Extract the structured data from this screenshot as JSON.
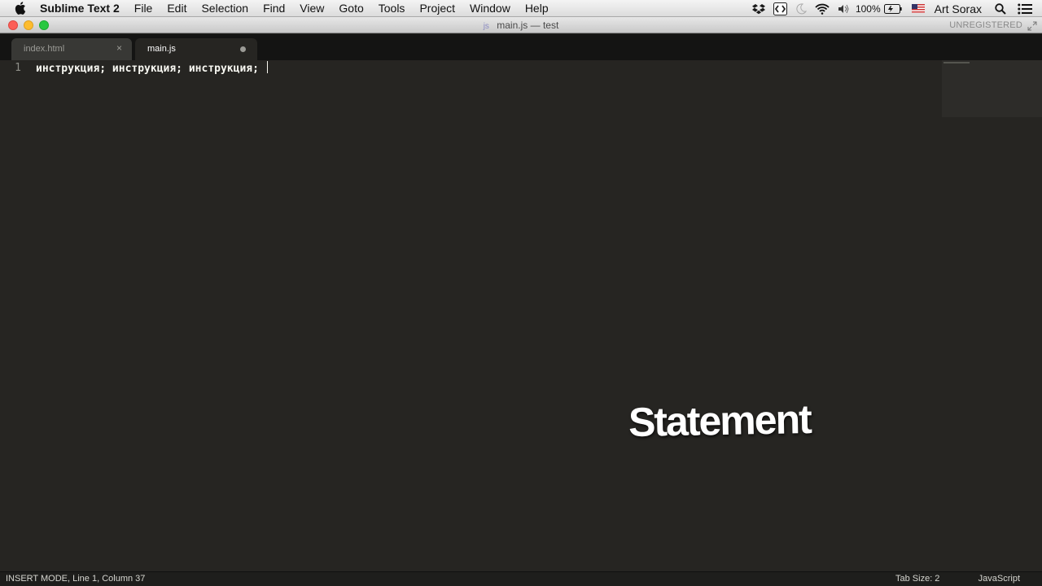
{
  "menubar": {
    "app_name": "Sublime Text 2",
    "items": [
      "File",
      "Edit",
      "Selection",
      "Find",
      "View",
      "Goto",
      "Tools",
      "Project",
      "Window",
      "Help"
    ],
    "battery": "100%",
    "user": "Art Sorax",
    "icons": [
      "apple-icon",
      "dropbox-icon",
      "bracket-icon",
      "moon-icon",
      "wifi-icon",
      "volume-icon",
      "battery-icon",
      "flag-icon",
      "search-icon",
      "list-icon"
    ]
  },
  "window": {
    "title_prefix": "js",
    "title": "main.js — test",
    "registration": "UNREGISTERED"
  },
  "tabs": [
    {
      "label": "index.html",
      "state": "inactive"
    },
    {
      "label": "main.js",
      "state": "active",
      "dirty": true
    }
  ],
  "editor": {
    "line_numbers": [
      "1"
    ],
    "lines": [
      "инструкция; инструкция; инструкция; "
    ]
  },
  "overlay": {
    "caption": "Statement"
  },
  "statusbar": {
    "position": "INSERT MODE, Line 1, Column 37",
    "tab_size": "Tab Size: 2",
    "syntax": "JavaScript"
  },
  "colors": {
    "editor_background": "#262522",
    "tab_strip": "#141413",
    "text": "#f8f8f2"
  }
}
